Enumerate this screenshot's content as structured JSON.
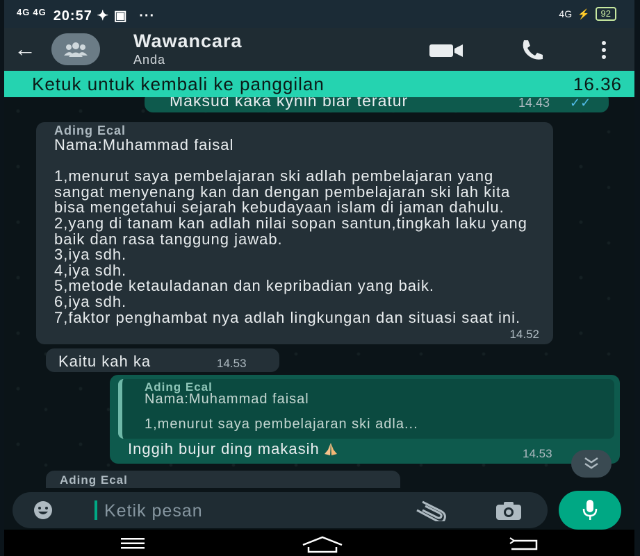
{
  "status_bar": {
    "network_left": "4G",
    "network_left2": "4G",
    "time": "20:57",
    "extra": "···",
    "network_right": "4G",
    "battery": "92"
  },
  "header": {
    "title": "Wawancara",
    "subtitle": "Anda"
  },
  "banner": {
    "text": "Ketuk untuk kembali ke panggilan",
    "time": "16.36"
  },
  "messages": [
    {
      "type": "out",
      "text": "Maksud kaka kynih biar teratur",
      "time": "14.43"
    },
    {
      "type": "in",
      "sender": "Ading Ecal",
      "text": "Nama:Muhammad faisal\n\n1,menurut saya pembelajaran     ski adlah pembelajaran yang sangat menyenang kan dan dengan pembelajaran ski lah kita bisa mengetahui sejarah kebudayaan islam di jaman dahulu.\n2,yang di tanam kan adlah nilai sopan santun,tingkah laku yang baik dan rasa tanggung jawab.\n3,iya sdh.\n4,iya sdh.\n5,metode ketauladanan dan kepribadian yang baik.\n6,iya sdh.\n7,faktor penghambat nya adlah lingkungan dan situasi saat ini.",
      "time": "14.52"
    },
    {
      "type": "in",
      "text": "Kaitu kah ka",
      "time": "14.53"
    },
    {
      "type": "out",
      "quote_sender": "Ading Ecal",
      "quote_line1": "Nama:Muhammad faisal",
      "quote_line2": "1,menurut saya pembelajaran     ski adla...",
      "text": "Inggih bujur ding makasih",
      "time": "14.53"
    },
    {
      "type": "in",
      "sender": "Ading Ecal"
    }
  ],
  "input": {
    "placeholder": "Ketik pesan"
  },
  "colors": {
    "accent": "#25d3b0",
    "header": "#1f2c33",
    "out_bubble": "#0e5a4d",
    "in_bubble": "#243037",
    "mic": "#00a884",
    "read_tick": "#53bdeb"
  }
}
